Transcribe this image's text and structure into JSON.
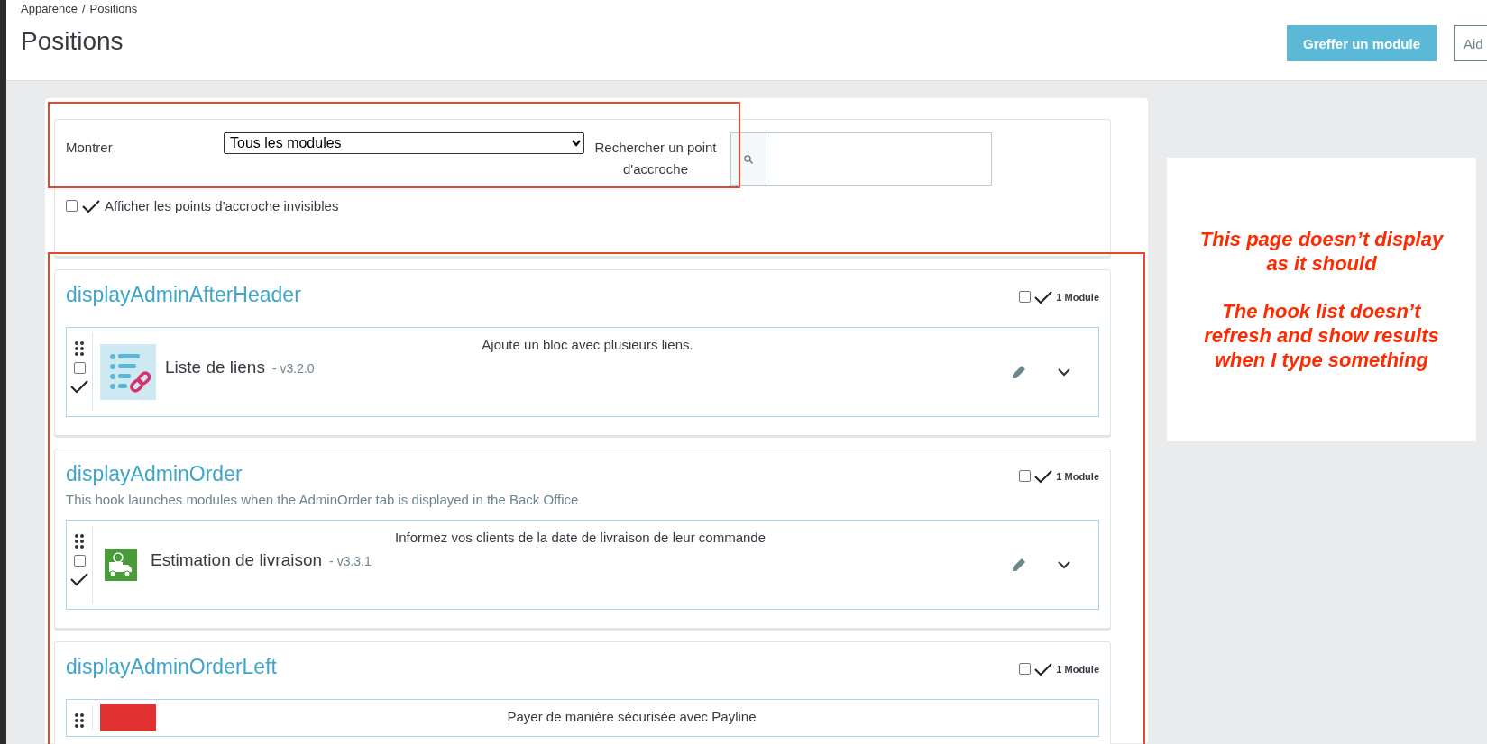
{
  "breadcrumb": [
    {
      "label": "Apparence",
      "separator": "/"
    },
    {
      "label": "Positions"
    }
  ],
  "page_title": "Positions",
  "header_buttons": [
    {
      "label": "Greffer un module",
      "kind": "primary"
    },
    {
      "label": "Aid",
      "kind": "outline"
    }
  ],
  "filter": {
    "show_label": "Montrer",
    "show_value": "Tous les modules",
    "search_label": "Rechercher un point d'accroche",
    "invisible_hooks": {
      "label": "Afficher les points d'accroche invisibles",
      "checked": false
    }
  },
  "hooks": [
    {
      "name": "displayAdminAfterHeader",
      "count": "1 Module",
      "checked": false,
      "modules": [
        {
          "kind": "links",
          "title": "Liste de liens",
          "version": "- v3.2.0",
          "description": "Ajoute un bloc avec plusieurs liens.",
          "checked": false
        }
      ]
    },
    {
      "name": "displayAdminOrder",
      "description": "This hook launches modules when the AdminOrder tab is displayed in the Back Office",
      "count": "1 Module",
      "checked": false,
      "modules": [
        {
          "kind": "truck",
          "title": "Estimation de livraison",
          "version": "- v3.3.1",
          "description": "Informez vos clients de la date de livraison de leur commande",
          "checked": false
        }
      ]
    },
    {
      "name": "displayAdminOrderLeft",
      "count": "1 Module",
      "checked": false,
      "modules": [
        {
          "kind": "logo",
          "description": "Payer de manière sécurisée avec Payline"
        }
      ]
    }
  ],
  "note": [
    "This page doesn’t display as it should",
    "The hook list doesn’t refresh and show results when I type something"
  ]
}
